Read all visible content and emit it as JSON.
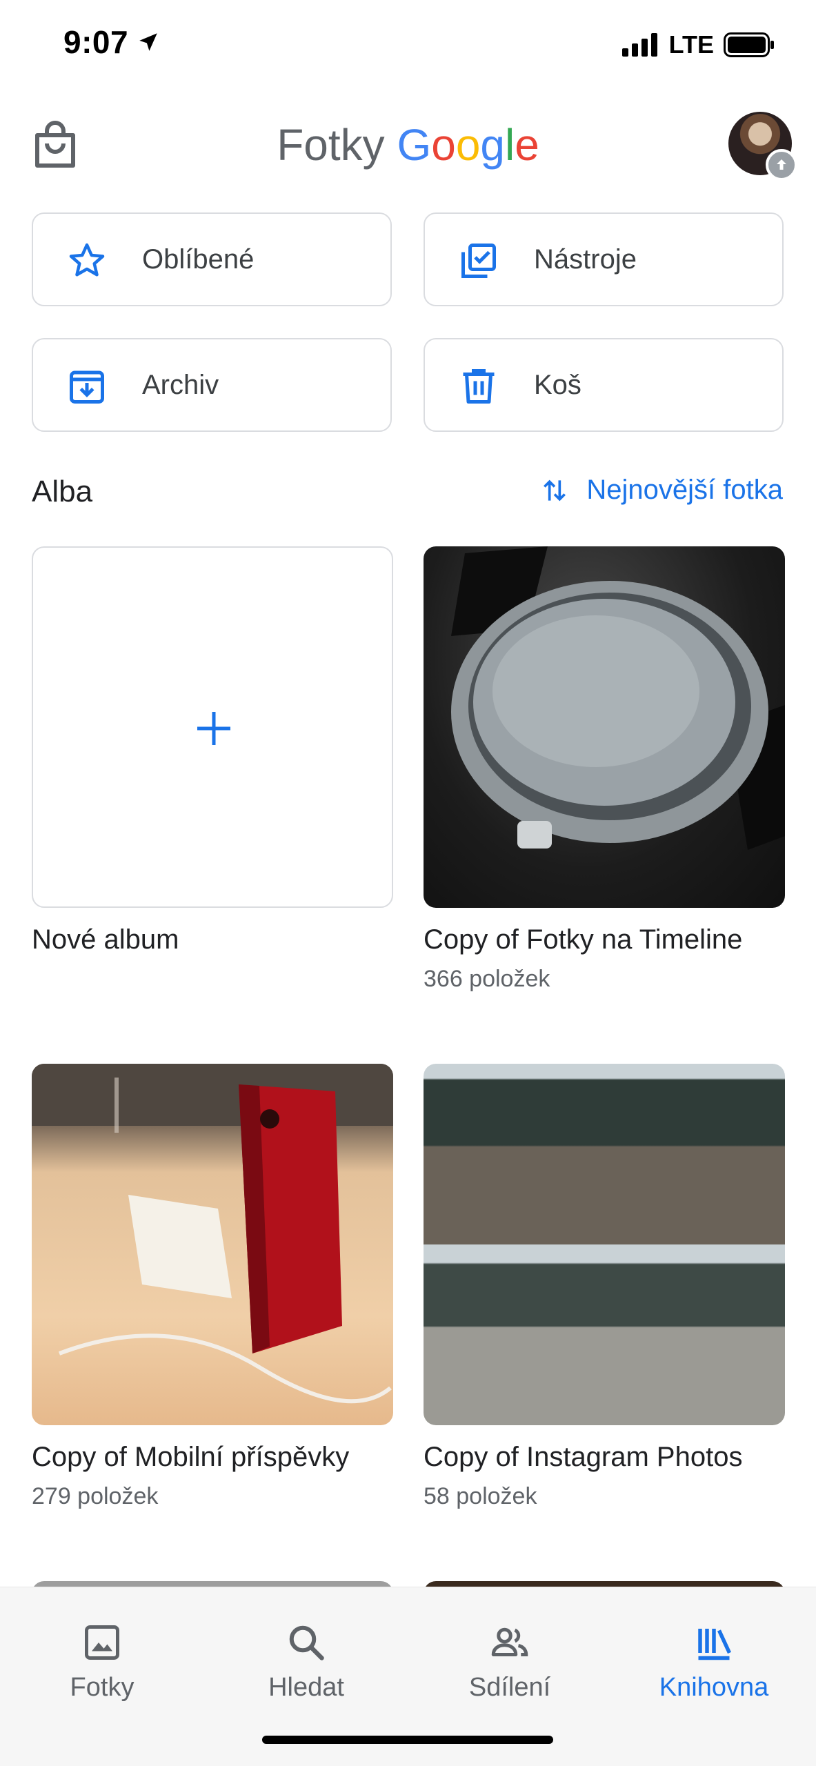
{
  "status_bar": {
    "time": "9:07",
    "network": "LTE"
  },
  "header": {
    "logo_word1": "Fotky",
    "logo_g": "G",
    "logo_o1": "o",
    "logo_o2": "o",
    "logo_g2": "g",
    "logo_l": "l",
    "logo_e": "e"
  },
  "quick_actions": [
    {
      "label": "Oblíbené",
      "icon": "star-icon"
    },
    {
      "label": "Nástroje",
      "icon": "tools-icon"
    },
    {
      "label": "Archiv",
      "icon": "archive-icon"
    },
    {
      "label": "Koš",
      "icon": "trash-icon"
    }
  ],
  "albums_section": {
    "title": "Alba",
    "sort_label": "Nejnovější fotka"
  },
  "albums": [
    {
      "title": "Nové album",
      "count": ""
    },
    {
      "title": "Copy of Fotky na Timeline",
      "count": "366 položek"
    },
    {
      "title": "Copy of Mobilní příspěvky",
      "count": "279 položek"
    },
    {
      "title": "Copy of Instagram Photos",
      "count": "58 položek"
    }
  ],
  "bottom_nav": [
    {
      "label": "Fotky",
      "icon": "photo-icon"
    },
    {
      "label": "Hledat",
      "icon": "search-icon"
    },
    {
      "label": "Sdílení",
      "icon": "people-icon"
    },
    {
      "label": "Knihovna",
      "icon": "library-icon",
      "active": true
    }
  ],
  "colors": {
    "accent": "#1a73e8",
    "border": "#dadce0",
    "text_secondary": "#5f6368"
  }
}
